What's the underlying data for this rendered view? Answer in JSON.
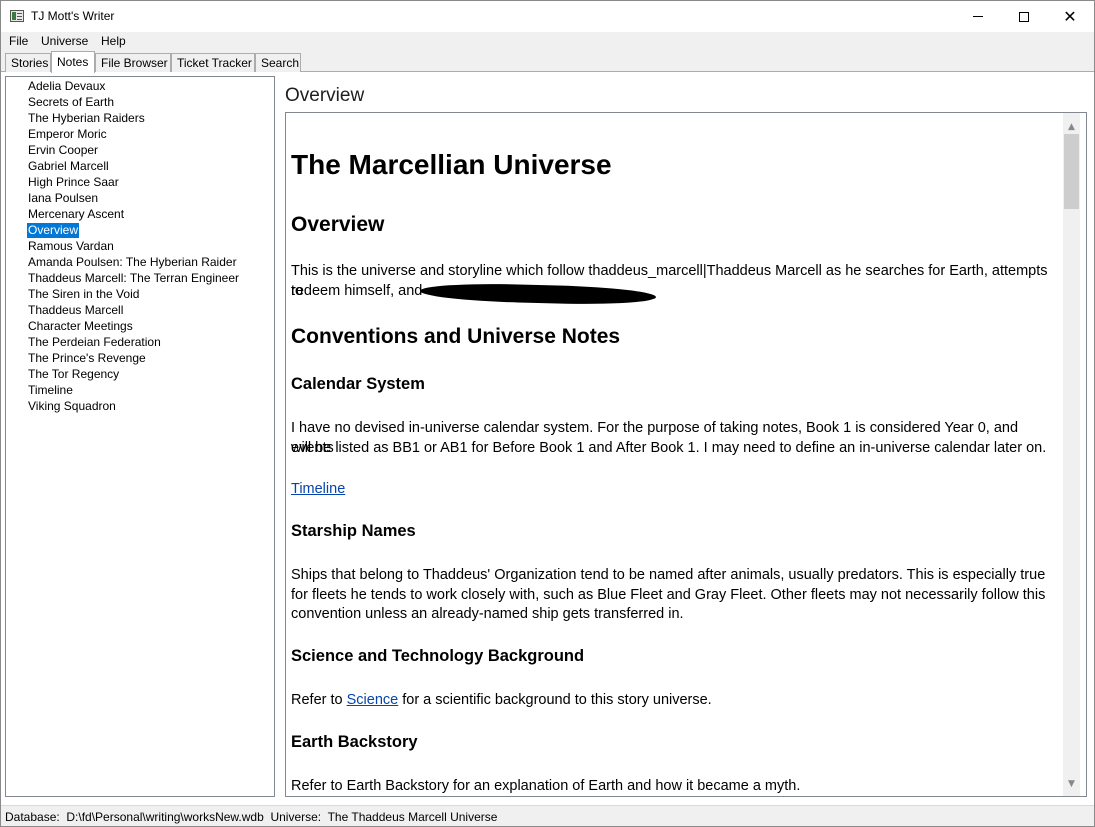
{
  "window": {
    "title": "TJ Mott's Writer"
  },
  "menu": {
    "file": "File",
    "universe": "Universe",
    "help": "Help"
  },
  "tabs": [
    {
      "label": "Stories",
      "active": false
    },
    {
      "label": "Notes",
      "active": true
    },
    {
      "label": "File Browser",
      "active": false
    },
    {
      "label": "Ticket Tracker",
      "active": false
    },
    {
      "label": "Search",
      "active": false
    }
  ],
  "notes": {
    "items": [
      "Adelia Devaux",
      "Secrets of Earth",
      "The Hyberian Raiders",
      "Emperor Moric",
      "Ervin Cooper",
      "Gabriel Marcell",
      "High Prince Saar",
      "Iana Poulsen",
      "Mercenary Ascent",
      "Overview",
      "Ramous Vardan",
      "Amanda Poulsen: The Hyberian Raider",
      "Thaddeus Marcell: The Terran Engineer",
      "The Siren in the Void",
      "Thaddeus Marcell",
      "Character Meetings",
      "The Perdeian Federation",
      "The Prince's Revenge",
      "The Tor Regency",
      "Timeline",
      "Viking Squadron"
    ],
    "selected": "Overview"
  },
  "content": {
    "title": "Overview",
    "doc": {
      "h1": "The Marcellian Universe",
      "overview_heading": "Overview",
      "overview_text_line1": "This is the universe and storyline which follow thaddeus_marcell|Thaddeus Marcell as he searches for Earth, attempts to",
      "overview_text_line2": "redeem himself, and",
      "conventions_heading": "Conventions and Universe Notes",
      "calendar_heading": "Calendar System",
      "calendar_line1": "I have no devised in-universe calendar system. For the purpose of taking notes, Book 1 is considered Year 0, and events",
      "calendar_line2": "will be listed as BB1 or AB1 for Before Book 1 and After Book 1. I may need to define an in-universe calendar later on.",
      "timeline_link": "Timeline",
      "starship_heading": "Starship Names",
      "starship_line1": "Ships that belong to Thaddeus' Organization tend to be named after animals, usually predators. This is especially true",
      "starship_line2": "for fleets he tends to work closely with, such as Blue Fleet and Gray Fleet. Other fleets may not necessarily follow this",
      "starship_line3": "convention unless an already-named ship gets transferred in.",
      "science_heading": "Science and Technology Background",
      "science_prefix": "Refer to ",
      "science_link": "Science",
      "science_suffix": " for a scientific background to this story universe.",
      "earth_heading": "Earth Backstory",
      "earth_text": "Refer to Earth Backstory for an explanation of Earth and how it became a myth."
    }
  },
  "status": {
    "text": "Database:  D:\\fd\\Personal\\writing\\worksNew.wdb  Universe:  The Thaddeus Marcell Universe"
  },
  "colors": {
    "selection": "#0078d7",
    "link": "#0645ad",
    "chrome": "#f0f0f0"
  }
}
